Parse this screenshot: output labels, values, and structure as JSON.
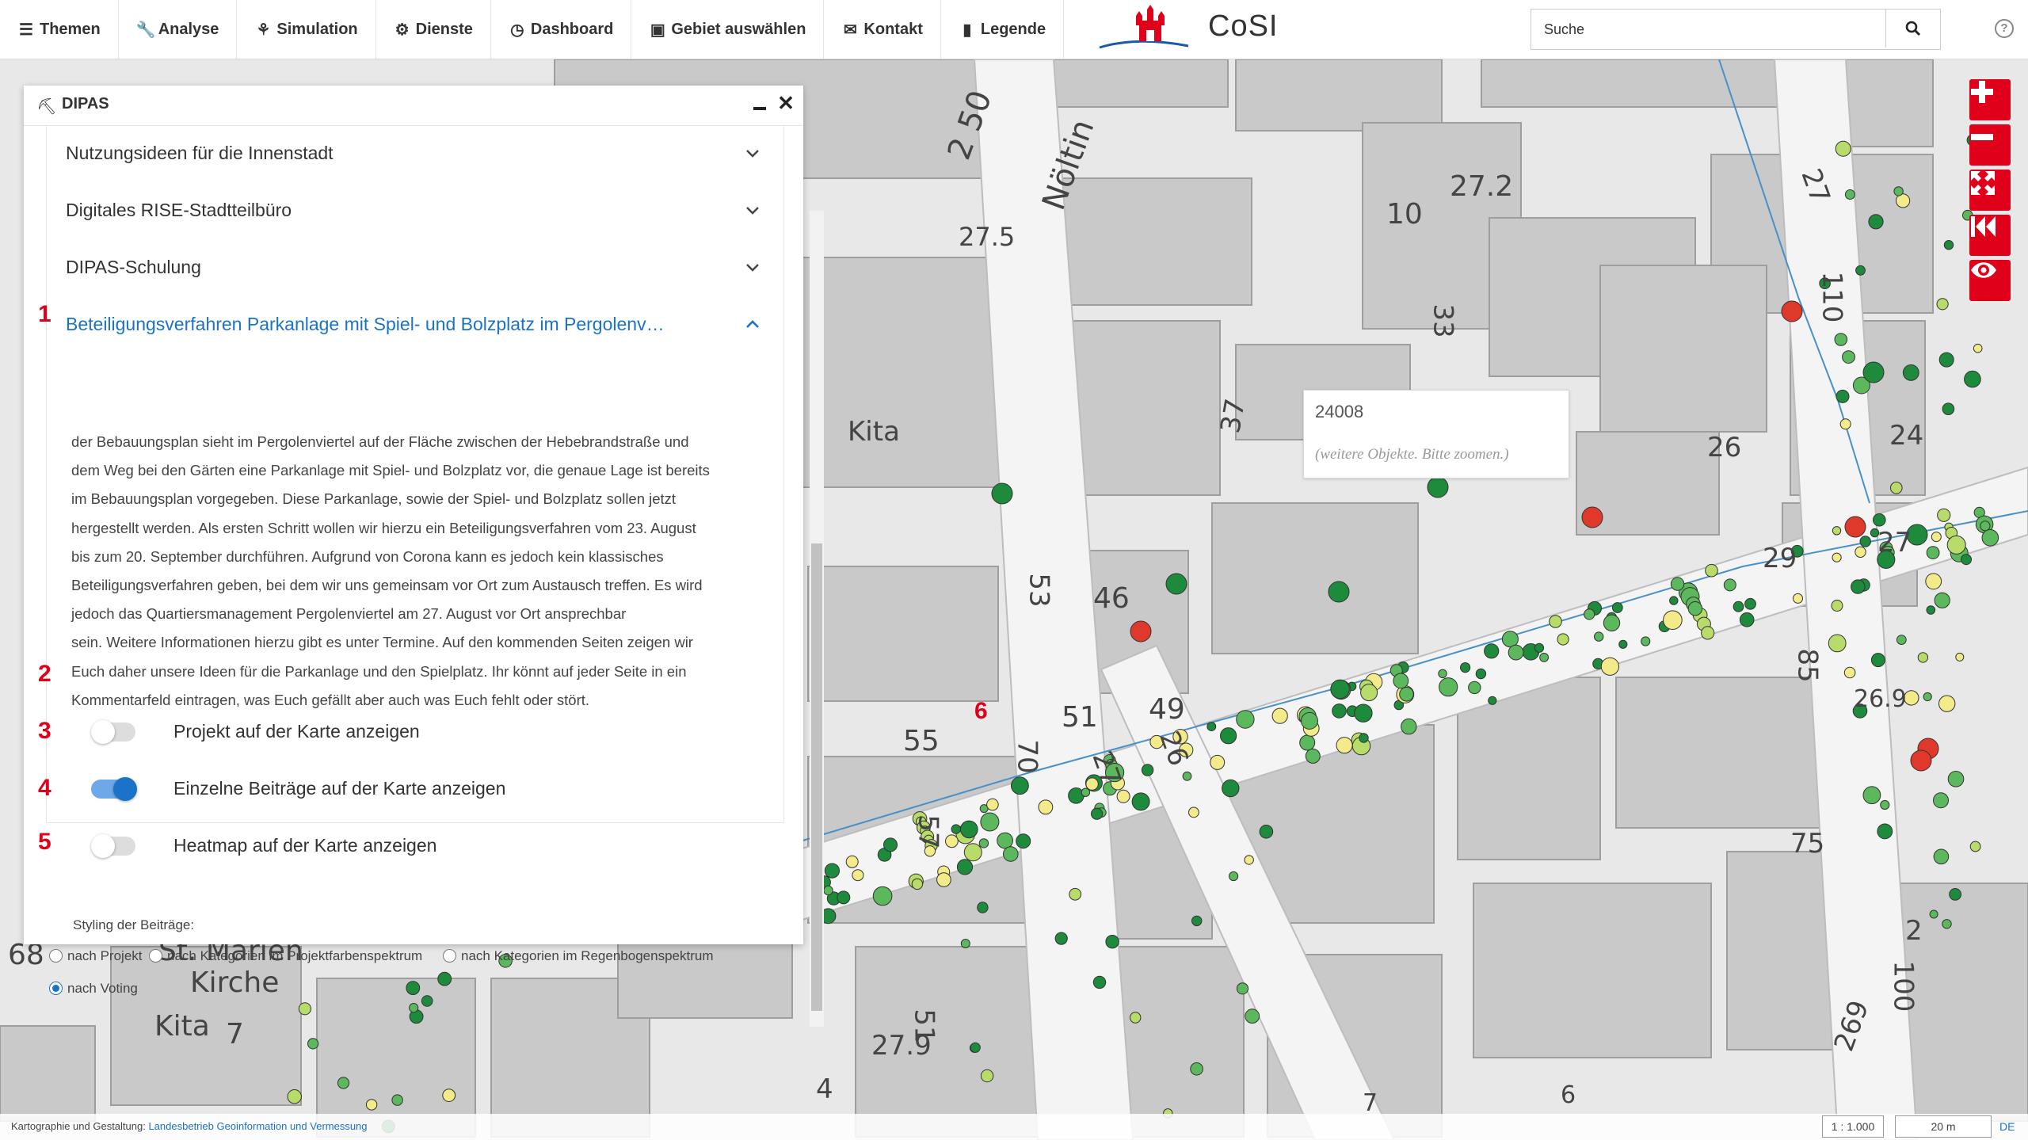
{
  "menu": [
    {
      "icon": "list-icon",
      "glyph": "☰",
      "label": "Themen"
    },
    {
      "icon": "wrench-icon",
      "glyph": "🔧",
      "label": "Analyse"
    },
    {
      "icon": "sprout-icon",
      "glyph": "⚘",
      "label": "Simulation"
    },
    {
      "icon": "gear-icon",
      "glyph": "⚙",
      "label": "Dienste"
    },
    {
      "icon": "dashboard-icon",
      "glyph": "◷",
      "label": "Dashboard"
    },
    {
      "icon": "image-icon",
      "glyph": "▣",
      "label": "Gebiet auswählen"
    },
    {
      "icon": "envelope-icon",
      "glyph": "✉",
      "label": "Kontakt"
    },
    {
      "icon": "book-icon",
      "glyph": "▮",
      "label": "Legende"
    }
  ],
  "brand": {
    "name": "CoSI",
    "accent": "#e10019"
  },
  "search": {
    "placeholder": "Suche"
  },
  "panel": {
    "title": "DIPAS",
    "accordion": [
      {
        "label": "Nutzungsideen für die Innenstadt",
        "expanded": false
      },
      {
        "label": "Digitales RISE-Stadtteilbüro",
        "expanded": false
      },
      {
        "label": "DIPAS-Schulung",
        "expanded": false
      },
      {
        "label": "Beteiligungsverfahren Parkanlage mit Spiel- und Bolzplatz im Pergolenv…",
        "expanded": true
      }
    ],
    "description": [
      "der Bebauungsplan sieht im Pergolenviertel auf der Fläche zwischen der Hebebrandstraße und",
      "dem Weg bei den Gärten eine Parkanlage mit Spiel- und Bolzplatz vor, die genaue Lage ist bereits",
      "im Bebauungsplan vorgegeben. Diese Parkanlage, sowie der Spiel- und Bolzplatz sollen jetzt",
      "hergestellt werden. Als ersten Schritt wollen wir hierzu ein Beteiligungsverfahren vom 23. August",
      "bis zum 20. September durchführen.   Aufgrund von Corona kann es jedoch kein klassisches",
      "Beteiligungsverfahren geben, bei dem wir uns gemeinsam vor Ort zum Austausch treffen. Es wird",
      "jedoch das Quartiersmanagement Pergolenviertel am 27. August vor Ort ansprechbar",
      "sein. Weitere Informationen hierzu gibt es unter Termine. Auf den kommenden Seiten zeigen wir",
      "Euch daher unsere Ideen für die Parkanlage und den Spielplatz. Ihr könnt auf jeder Seite in ein",
      "Kommentarfeld eintragen, was Euch gefällt aber auch was Euch fehlt oder stört."
    ],
    "toggles": [
      {
        "label": "Projekt auf der Karte anzeigen",
        "on": false
      },
      {
        "label": "Einzelne Beiträge auf der Karte anzeigen",
        "on": true
      },
      {
        "label": "Heatmap auf der Karte anzeigen",
        "on": false
      }
    ],
    "styling_label": "Styling der Beiträge:",
    "styling_options": [
      {
        "label": "nach Projekt",
        "checked": false
      },
      {
        "label": "nach Kategorien im Projektfarbenspektrum",
        "checked": false
      },
      {
        "label": "nach Kategorien im Regenbogenspektrum",
        "checked": false
      },
      {
        "label": "nach Voting",
        "checked": true
      }
    ]
  },
  "annotations": [
    "1",
    "2",
    "3",
    "4",
    "5",
    "6"
  ],
  "popup": {
    "id": "24008",
    "note": "(weitere Objekte. Bitte zoomen.)"
  },
  "map_labels": [
    "Nöltin",
    "Kita",
    "27.5",
    "2 50",
    "27.2",
    "10",
    "37",
    "33",
    "46",
    "53",
    "27",
    "55",
    "51",
    "70",
    "27",
    "49",
    "26",
    "57",
    "75",
    "85",
    "29",
    "27",
    "24",
    "26",
    "110",
    "68",
    "St. Marien",
    "Kirche",
    "Kita",
    "7",
    "27.9",
    "4",
    "100",
    "2",
    "269",
    "26.9",
    "6",
    "7",
    "51"
  ],
  "map_controls": [
    "zoom-in-icon",
    "zoom-out-icon",
    "fullscreen-icon",
    "back-icon",
    "eye-icon"
  ],
  "footer": {
    "prefix": "Kartographie und Gestaltung: ",
    "link": "Landesbetrieb Geoinformation und Vermessung",
    "scale": "1 : 1.000",
    "scale_bar": "20 m",
    "lang": "DE"
  },
  "colors": {
    "vote_dark": "#1e8a3c",
    "vote_mid": "#5cb85c",
    "vote_light": "#b8dc6a",
    "vote_yellow": "#f3ea8a",
    "vote_red": "#e0382b",
    "active_blue": "#1a73c8"
  }
}
